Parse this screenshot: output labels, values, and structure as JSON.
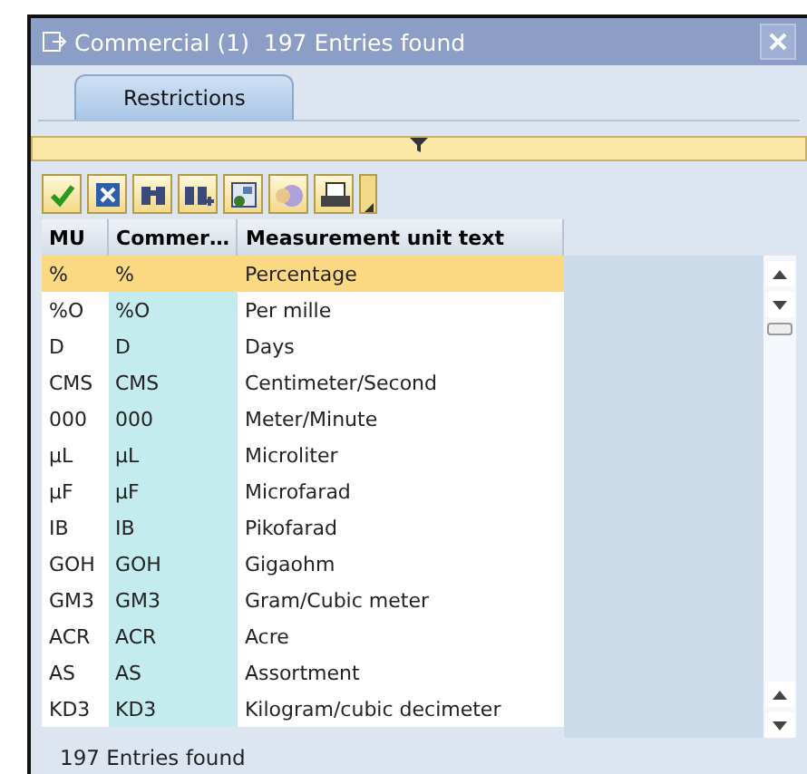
{
  "window": {
    "title": "Commercial (1)  197 Entries found"
  },
  "tabs": [
    {
      "label": "Restrictions",
      "selected": true
    }
  ],
  "toolbar": [
    {
      "kind": "check"
    },
    {
      "kind": "cancel"
    },
    {
      "kind": "find"
    },
    {
      "kind": "find-next"
    },
    {
      "kind": "image"
    },
    {
      "kind": "help"
    },
    {
      "kind": "print"
    }
  ],
  "table": {
    "columns": [
      "MU",
      "Commer…",
      "Measurement unit text"
    ],
    "rows": [
      {
        "mu": "%",
        "commercial": "%",
        "text": "Percentage",
        "selected": true
      },
      {
        "mu": "%O",
        "commercial": "%O",
        "text": "Per mille",
        "selected": false
      },
      {
        "mu": "D",
        "commercial": "D",
        "text": "Days",
        "selected": false
      },
      {
        "mu": "CMS",
        "commercial": "CMS",
        "text": "Centimeter/Second",
        "selected": false
      },
      {
        "mu": "000",
        "commercial": "000",
        "text": "Meter/Minute",
        "selected": false
      },
      {
        "mu": "µL",
        "commercial": "µL",
        "text": "Microliter",
        "selected": false
      },
      {
        "mu": "µF",
        "commercial": "µF",
        "text": "Microfarad",
        "selected": false
      },
      {
        "mu": "IB",
        "commercial": "IB",
        "text": "Pikofarad",
        "selected": false
      },
      {
        "mu": "GOH",
        "commercial": "GOH",
        "text": "Gigaohm",
        "selected": false
      },
      {
        "mu": "GM3",
        "commercial": "GM3",
        "text": "Gram/Cubic meter",
        "selected": false
      },
      {
        "mu": "ACR",
        "commercial": "ACR",
        "text": "Acre",
        "selected": false
      },
      {
        "mu": "AS",
        "commercial": "AS",
        "text": "Assortment",
        "selected": false
      },
      {
        "mu": "KD3",
        "commercial": "KD3",
        "text": "Kilogram/cubic decimeter",
        "selected": false
      }
    ]
  },
  "status_bar": {
    "text": "197 Entries found"
  }
}
